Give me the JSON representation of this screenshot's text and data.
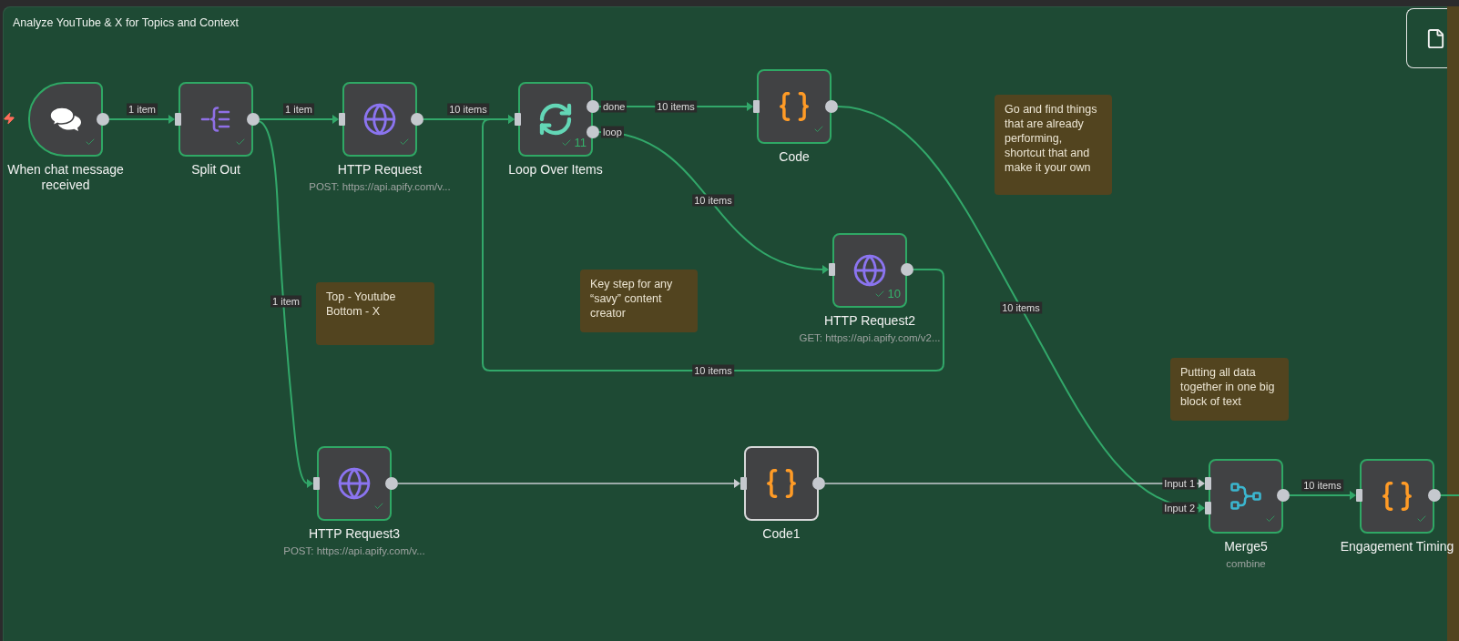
{
  "workflow_group": {
    "title": "Analyze YouTube & X for Topics and Context"
  },
  "sticky_notes": [
    {
      "text": "Go and find things that are already performing, shortcut that and make it your own"
    },
    {
      "text": "Top - Youtube\nBottom - X"
    },
    {
      "text": "Key step for any “savy” content creator"
    },
    {
      "text": "Putting all data together in one big block of text"
    }
  ],
  "nodes": [
    {
      "kind": "trigger",
      "name": "When chat message received",
      "executed": true
    },
    {
      "kind": "split",
      "name": "Split Out",
      "executed": true
    },
    {
      "kind": "http",
      "name": "HTTP Request",
      "subtitle": "POST: https://api.apify.com/v...",
      "executed": true
    },
    {
      "kind": "loop",
      "name": "Loop Over Items",
      "executed": true,
      "run_count": "11",
      "outputs": [
        "done",
        "loop"
      ]
    },
    {
      "kind": "code",
      "name": "Code",
      "executed": true
    },
    {
      "kind": "http",
      "name": "HTTP Request2",
      "subtitle": "GET: https://api.apify.com/v2...",
      "executed": true,
      "run_count": "10"
    },
    {
      "kind": "http",
      "name": "HTTP Request3",
      "subtitle": "POST: https://api.apify.com/v...",
      "executed": true
    },
    {
      "kind": "code",
      "name": "Code1",
      "executed": false
    },
    {
      "kind": "merge",
      "name": "Merge5",
      "subtitle": "combine",
      "executed": true,
      "inputs": [
        "Input 1",
        "Input 2"
      ]
    },
    {
      "kind": "code",
      "name": "Engagement Timing",
      "executed": true
    }
  ],
  "connections": [
    {
      "label": "1 item",
      "active": true
    },
    {
      "label": "1 item",
      "active": true
    },
    {
      "label": "10 items",
      "active": true
    },
    {
      "label": "1 item",
      "active": true
    },
    {
      "label": "10 items",
      "active": true
    },
    {
      "label": "10 items",
      "active": true
    },
    {
      "label": "10 items",
      "active": true
    },
    {
      "label": "10 items",
      "active": true
    },
    {
      "active": false
    },
    {
      "active": false
    },
    {
      "label": "10 items",
      "active": true
    },
    {
      "active": true
    }
  ]
}
